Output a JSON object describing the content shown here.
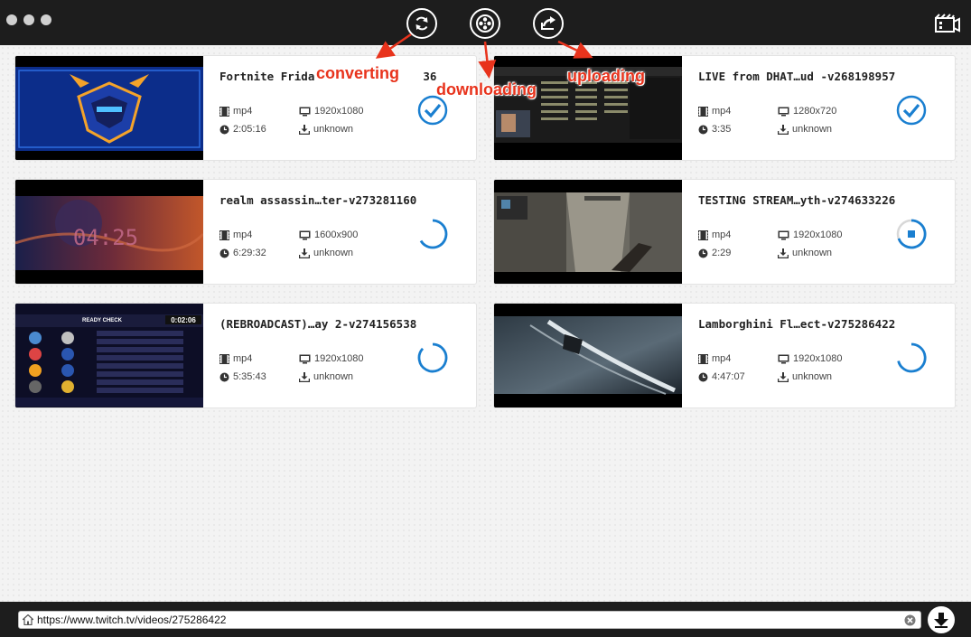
{
  "window": {
    "controls": [
      "close",
      "minimize",
      "zoom"
    ]
  },
  "toolbar": {
    "buttons": [
      {
        "name": "convert",
        "icon": "refresh-icon"
      },
      {
        "name": "download",
        "icon": "film-reel-icon"
      },
      {
        "name": "upload",
        "icon": "share-icon"
      }
    ],
    "right_icon": "video-library-icon"
  },
  "annotations": {
    "converting": "converting",
    "downloading": "downloading",
    "uploading": "uploading"
  },
  "videos": [
    {
      "title": "Fortnite Frida",
      "title_tail": "36",
      "format": "mp4",
      "resolution": "1920x1080",
      "duration": "2:05:16",
      "size": "unknown",
      "status": "done"
    },
    {
      "title": "LIVE from DHAT…ud -v268198957",
      "format": "mp4",
      "resolution": "1280x720",
      "duration": "3:35",
      "size": "unknown",
      "status": "done"
    },
    {
      "title": "realm assassin…ter-v273281160",
      "format": "mp4",
      "resolution": "1600x900",
      "duration": "6:29:32",
      "size": "unknown",
      "status": "loading"
    },
    {
      "title": "TESTING STREAM…yth-v274633226",
      "format": "mp4",
      "resolution": "1920x1080",
      "duration": "2:29",
      "size": "unknown",
      "status": "stop"
    },
    {
      "title": "(REBROADCAST)…ay 2-v274156538",
      "format": "mp4",
      "resolution": "1920x1080",
      "duration": "5:35:43",
      "size": "unknown",
      "status": "loading"
    },
    {
      "title": "Lamborghini Fl…ect-v275286422",
      "format": "mp4",
      "resolution": "1920x1080",
      "duration": "4:47:07",
      "size": "unknown",
      "status": "loading"
    }
  ],
  "thumbs": {
    "t1": {
      "text": ""
    },
    "t3": {
      "text": "04:25"
    },
    "t5": {
      "header": "READY CHECK",
      "timer": "0:02:06"
    }
  },
  "url_bar": {
    "value": "https://www.twitch.tv/videos/275286422"
  },
  "colors": {
    "accent": "#1a7fd0",
    "annotation": "#e8331c",
    "bar": "#1d1d1d"
  }
}
